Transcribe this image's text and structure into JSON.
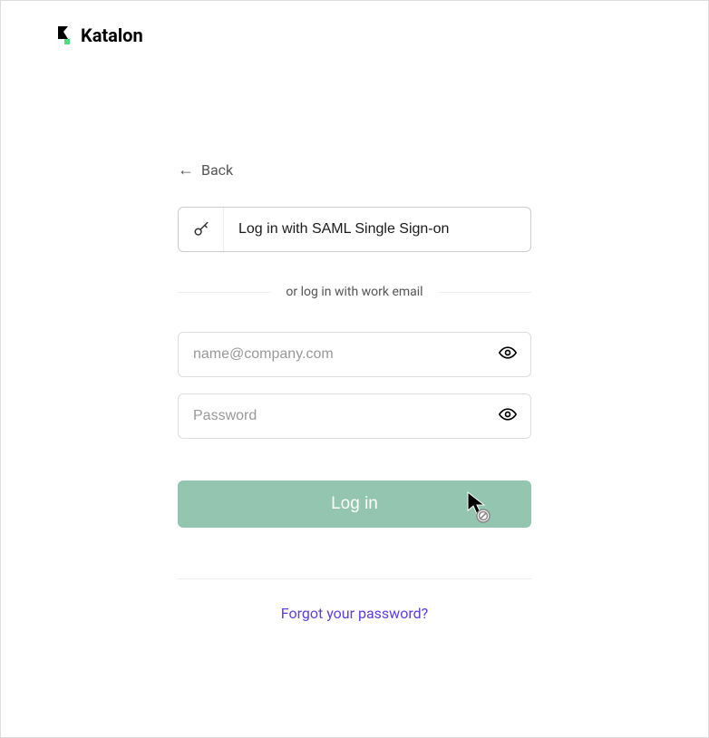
{
  "brand": {
    "name": "Katalon"
  },
  "back": {
    "label": "Back"
  },
  "sso": {
    "label": "Log in with SAML Single Sign-on"
  },
  "divider": {
    "text": "or log in with work email"
  },
  "email": {
    "placeholder": "name@company.com",
    "value": ""
  },
  "password": {
    "placeholder": "Password",
    "value": ""
  },
  "login": {
    "label": "Log in"
  },
  "forgot": {
    "label": "Forgot your password?"
  }
}
